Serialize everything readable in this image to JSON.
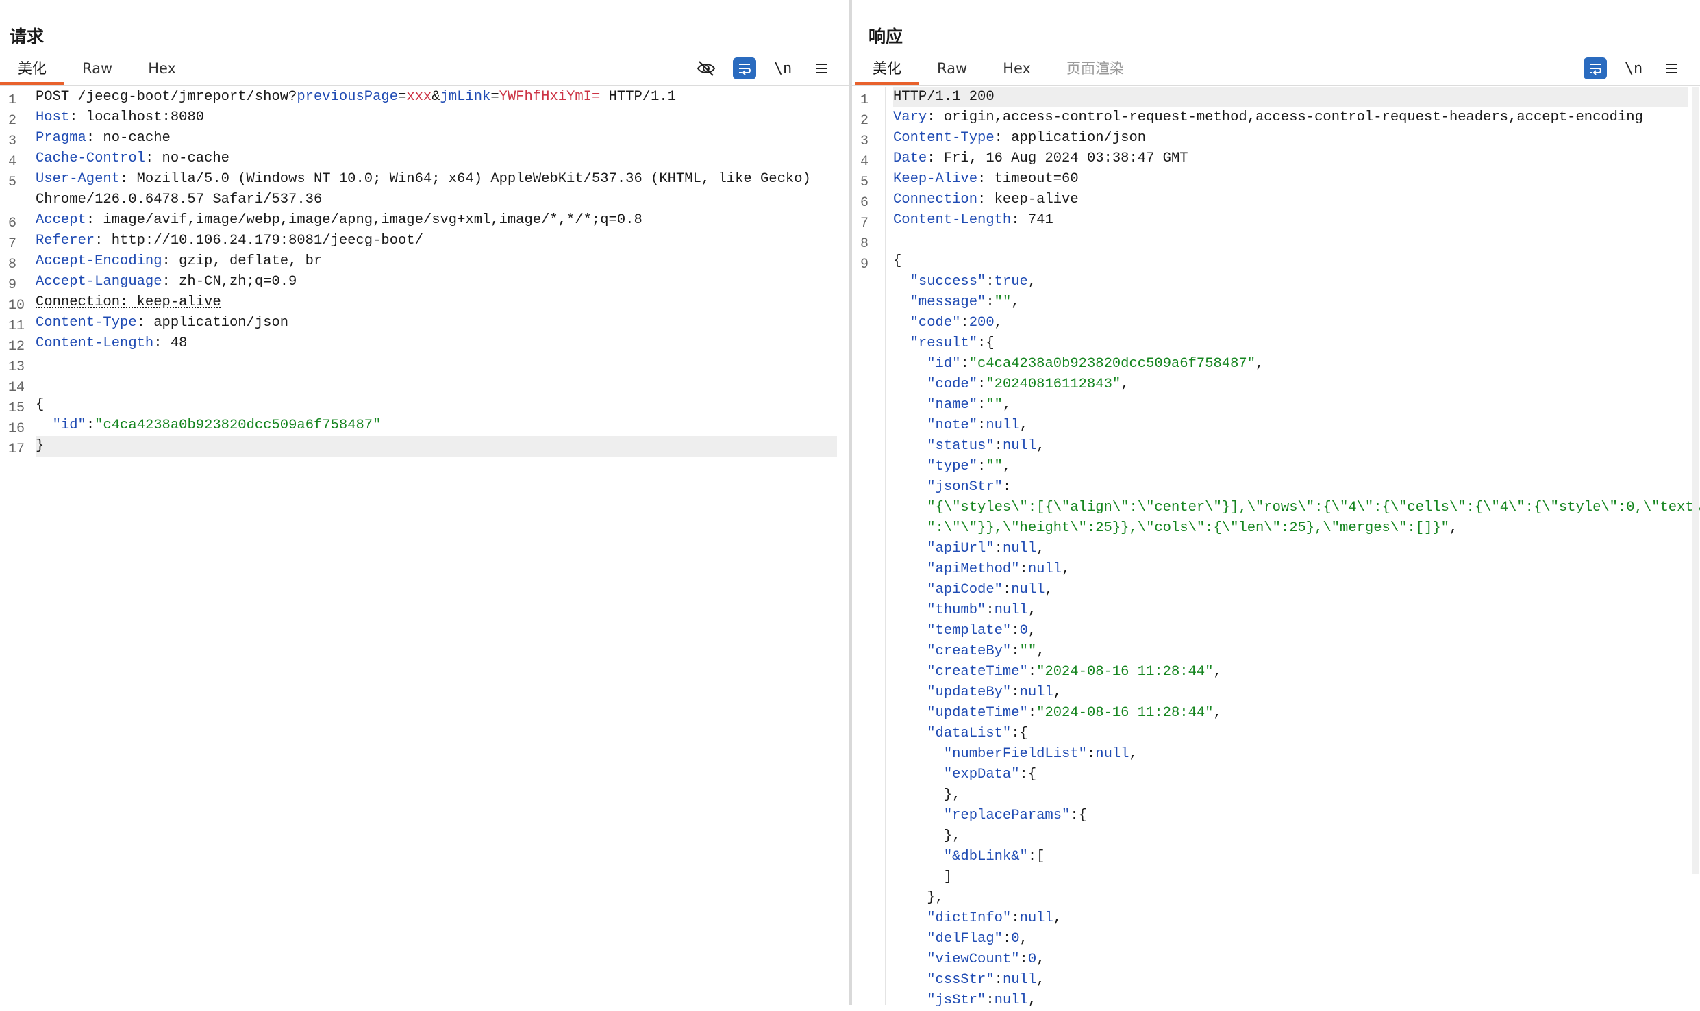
{
  "request": {
    "title": "请求",
    "tabs": [
      {
        "label": "美化",
        "active": true
      },
      {
        "label": "Raw",
        "active": false
      },
      {
        "label": "Hex",
        "active": false
      }
    ],
    "tools": {
      "wrap_label": "\\n"
    }
  },
  "response": {
    "title": "响应",
    "tabs": [
      {
        "label": "美化",
        "active": true
      },
      {
        "label": "Raw",
        "active": false
      },
      {
        "label": "Hex",
        "active": false
      },
      {
        "label": "页面渲染",
        "active": false
      }
    ],
    "tools": {
      "wrap_label": "\\n"
    }
  },
  "colors": {
    "accent": "#e8612c",
    "key": "#1f4bb3",
    "param": "#cc3344",
    "string": "#15851f",
    "tool_blue": "#2a6bbf"
  },
  "icons": [
    "hide-icon",
    "wrap-icon",
    "menu-icon",
    "layout-split-icon",
    "layout-rows-icon",
    "layout-single-icon"
  ]
}
